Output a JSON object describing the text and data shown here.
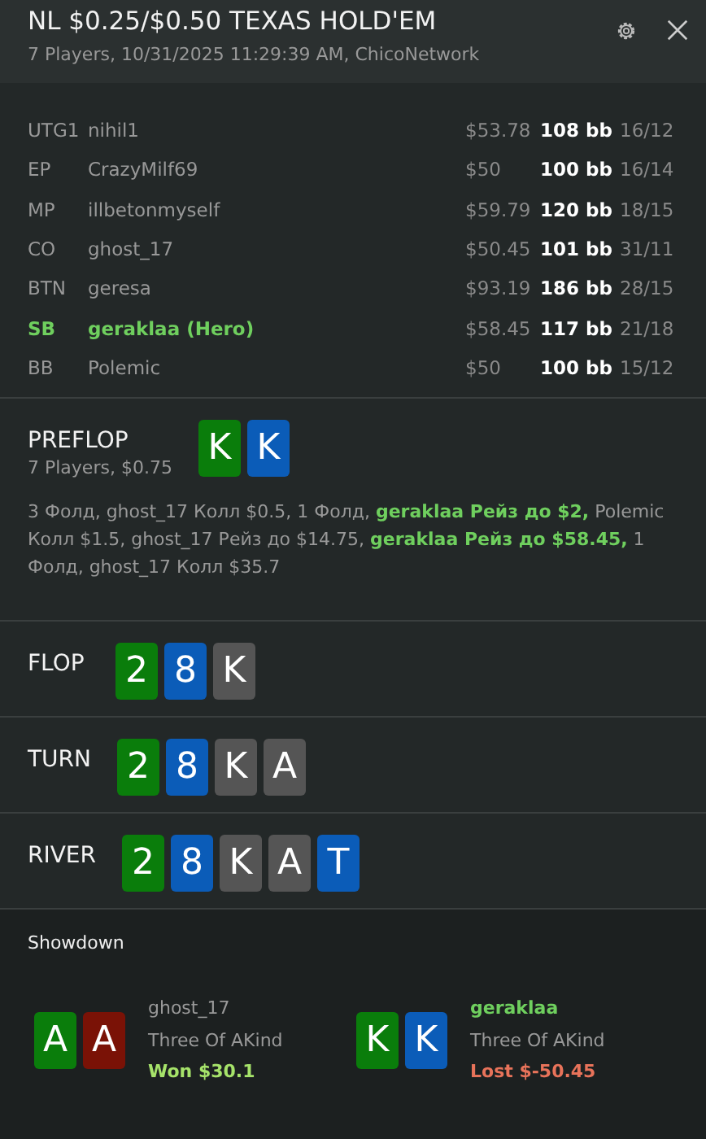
{
  "header": {
    "title": "NL $0.25/$0.50 TEXAS HOLD'EM",
    "subtitle": "7 Players, 10/31/2025 11:29:39 AM, ChicoNetwork"
  },
  "players": [
    {
      "position": "UTG1",
      "name": "nihil1",
      "stack": "$53.78",
      "bb": "108 bb",
      "stats": "16/12",
      "hero": false
    },
    {
      "position": "EP",
      "name": "CrazyMilf69",
      "stack": "$50",
      "bb": "100 bb",
      "stats": "16/14",
      "hero": false
    },
    {
      "position": "MP",
      "name": "illbetonmyself",
      "stack": "$59.79",
      "bb": "120 bb",
      "stats": "18/15",
      "hero": false
    },
    {
      "position": "CO",
      "name": "ghost_17",
      "stack": "$50.45",
      "bb": "101 bb",
      "stats": "31/11",
      "hero": false
    },
    {
      "position": "BTN",
      "name": "geresa",
      "stack": "$93.19",
      "bb": "186 bb",
      "stats": "28/15",
      "hero": false
    },
    {
      "position": "SB",
      "name": "geraklaa (Hero)",
      "stack": "$58.45",
      "bb": "117 bb",
      "stats": "21/18",
      "hero": true
    },
    {
      "position": "BB",
      "name": "Polemic",
      "stack": "$50",
      "bb": "100 bb",
      "stats": "15/12",
      "hero": false
    }
  ],
  "streets": [
    {
      "name": "PREFLOP",
      "info": "7 Players, $0.75",
      "actions": "3 Фолд, ghost_17 Колл $0.5, 1 Фолд, **geraklaa Рейз до $2,** Polemic Колл $1.5, ghost_17 Рейз до $14.75, **geraklaa Рейз до $58.45,** 1 Фолд, ghost_17 Колл $35.7",
      "cards": [
        {
          "rank": "K",
          "color": "#0a7d0b"
        },
        {
          "rank": "K",
          "color": "#0b5cb8"
        }
      ]
    },
    {
      "name": "FLOP",
      "cards": [
        {
          "rank": "2",
          "color": "#0a7d0b"
        },
        {
          "rank": "8",
          "color": "#0b5cb8"
        },
        {
          "rank": "K",
          "color": "#555555"
        }
      ]
    },
    {
      "name": "TURN",
      "cards": [
        {
          "rank": "2",
          "color": "#0a7d0b"
        },
        {
          "rank": "8",
          "color": "#0b5cb8"
        },
        {
          "rank": "K",
          "color": "#555555"
        },
        {
          "rank": "A",
          "color": "#555555"
        }
      ]
    },
    {
      "name": "RIVER",
      "cards": [
        {
          "rank": "2",
          "color": "#0a7d0b"
        },
        {
          "rank": "8",
          "color": "#0b5cb8"
        },
        {
          "rank": "K",
          "color": "#555555"
        },
        {
          "rank": "A",
          "color": "#555555"
        },
        {
          "rank": "T",
          "color": "#0b5cb8"
        }
      ]
    }
  ],
  "showdown": {
    "title": "Showdown",
    "hands": [
      {
        "player": "ghost_17",
        "hero": false,
        "hand": "Three Of AKind",
        "result": "Won $30.1",
        "kind": "won",
        "cards": [
          {
            "rank": "A",
            "color": "#0a7d0b"
          },
          {
            "rank": "A",
            "color": "#7a1206"
          }
        ]
      },
      {
        "player": "geraklaa",
        "hero": true,
        "hand": "Three Of AKind",
        "result": "Lost $-50.45",
        "kind": "lost",
        "cards": [
          {
            "rank": "K",
            "color": "#0a7d0b"
          },
          {
            "rank": "K",
            "color": "#0b5cb8"
          }
        ]
      }
    ]
  }
}
